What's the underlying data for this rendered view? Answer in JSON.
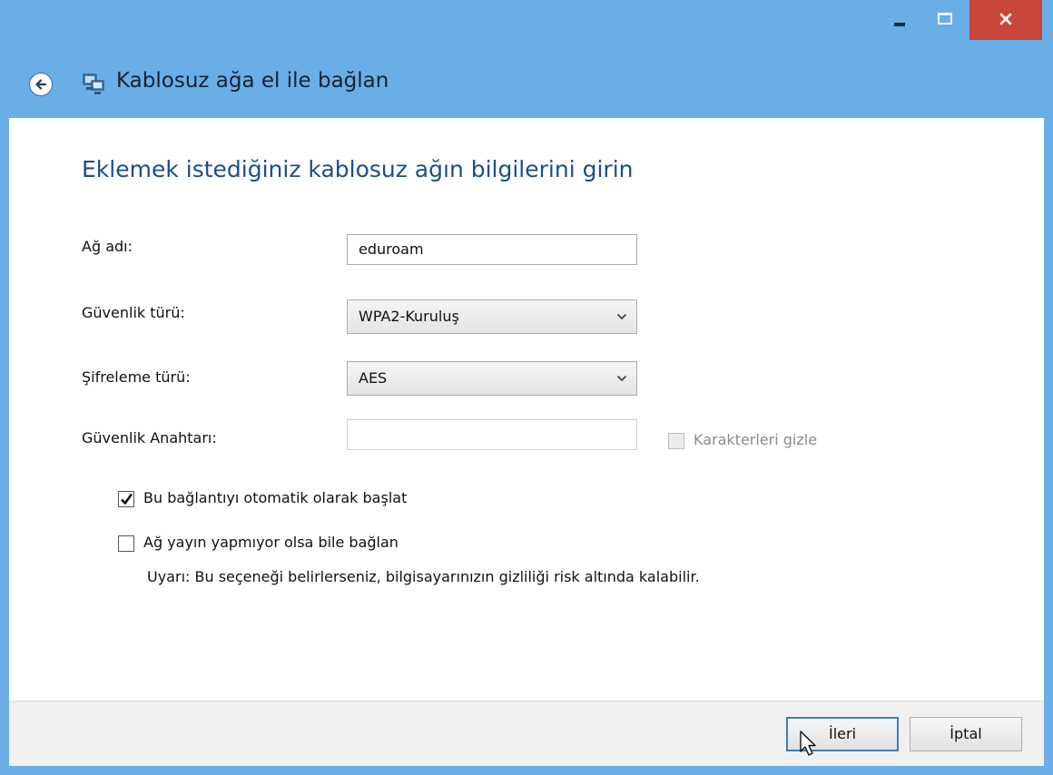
{
  "window": {
    "title": "Kablosuz ağa el ile bağlan",
    "colors": {
      "chrome": "#6aaee8",
      "close": "#c7473a",
      "heading": "#1c4e8c"
    }
  },
  "titlebar": {
    "minimize_icon": "minimize-icon",
    "maximize_icon": "maximize-icon",
    "close_glyph": "×"
  },
  "form": {
    "heading": "Eklemek istediğiniz kablosuz ağın bilgilerini girin",
    "network_name": {
      "label": "Ağ adı:",
      "value": "eduroam"
    },
    "security_type": {
      "label": "Güvenlik türü:",
      "value": "WPA2-Kuruluş"
    },
    "encryption_type": {
      "label": "Şifreleme türü:",
      "value": "AES"
    },
    "security_key": {
      "label": "Güvenlik Anahtarı:",
      "value": "",
      "hide_label": "Karakterleri gizle",
      "hide_checked": false,
      "enabled": false
    },
    "auto_connect": {
      "label": "Bu bağlantıyı otomatik olarak başlat",
      "checked": true
    },
    "connect_hidden": {
      "label": "Ağ yayın yapmıyor olsa bile bağlan",
      "checked": false
    },
    "warning": "Uyarı: Bu seçeneği belirlerseniz, bilgisayarınızın gizliliği risk altında kalabilir."
  },
  "footer": {
    "next_label": "İleri",
    "cancel_label": "İptal"
  }
}
